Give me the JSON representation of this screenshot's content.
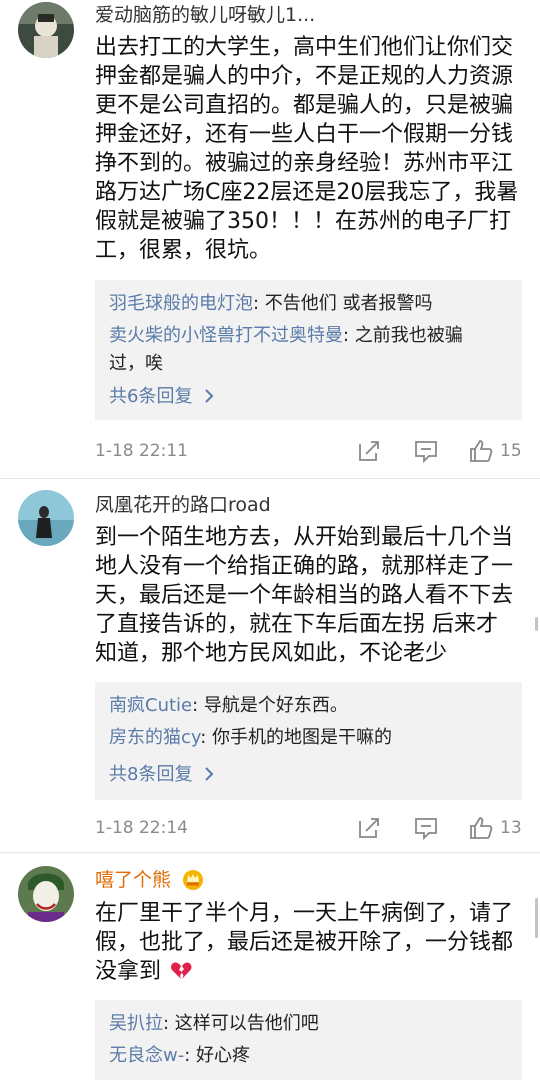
{
  "colors": {
    "reply_user": "#5b7ba9",
    "reply_bg": "#f2f2f2",
    "vip_username": "#e06b00",
    "muted": "#8a8a8a"
  },
  "comments": [
    {
      "username": "爱动脑筋的敏儿呀敏儿1...",
      "body_lines": [
        "出去打工的大学生，高中生们他们让你们交",
        "押金都是骗人的中介，不是正规的人力资源",
        "更不是公司直招的。都是骗人的，只是被骗",
        "押金还好，还有一些人白干一个假期一分钱",
        "挣不到的。被骗过的亲身经验！苏州市平江",
        "路万达广场C座22层还是20层我忘了，我暑",
        "假就是被骗了350！！！在苏州的电子厂打",
        "工，很累，很坑。"
      ],
      "replies": [
        {
          "user": "羽毛球般的电灯泡",
          "text": ": 不告他们 或者报警吗"
        },
        {
          "user": "卖火柴的小怪兽打不过奥特曼",
          "text": ": 之前我也被骗",
          "text2": "过，唉"
        }
      ],
      "more_replies": "共6条回复",
      "timestamp": "1-18 22:11",
      "likes": "15"
    },
    {
      "username": "凤凰花开的路口road",
      "body_lines": [
        "到一个陌生地方去，从开始到最后十几个当",
        "地人没有一个给指正确的路，就那样走了一",
        "天，最后还是一个年龄相当的路人看不下去",
        "了直接告诉的，就在下车后面左拐 后来才",
        "知道，那个地方民风如此，不论老少"
      ],
      "replies": [
        {
          "user": "南疯Cutie",
          "text": ": 导航是个好东西。"
        },
        {
          "user": "房东的猫cy",
          "text": ": 你手机的地图是干嘛的"
        }
      ],
      "more_replies": "共8条回复",
      "timestamp": "1-18 22:14",
      "likes": "13"
    },
    {
      "username": "嘻了个熊",
      "body_lines": [
        "在厂里干了半个月，一天上午病倒了，请了",
        "假，也批了，最后还是被开除了，一分钱都",
        "没拿到"
      ],
      "replies": [
        {
          "user": "吴扒拉",
          "text": ": 这样可以告他们吧"
        },
        {
          "user": "无良念w-",
          "text": ": 好心疼"
        }
      ]
    }
  ],
  "icons": {
    "forward": "forward-icon",
    "comment": "comment-icon",
    "like": "thumbs-up-icon",
    "more": "chevron-right-icon",
    "broken_heart": "broken-heart-icon",
    "vip_badge": "crown-badge-icon"
  }
}
